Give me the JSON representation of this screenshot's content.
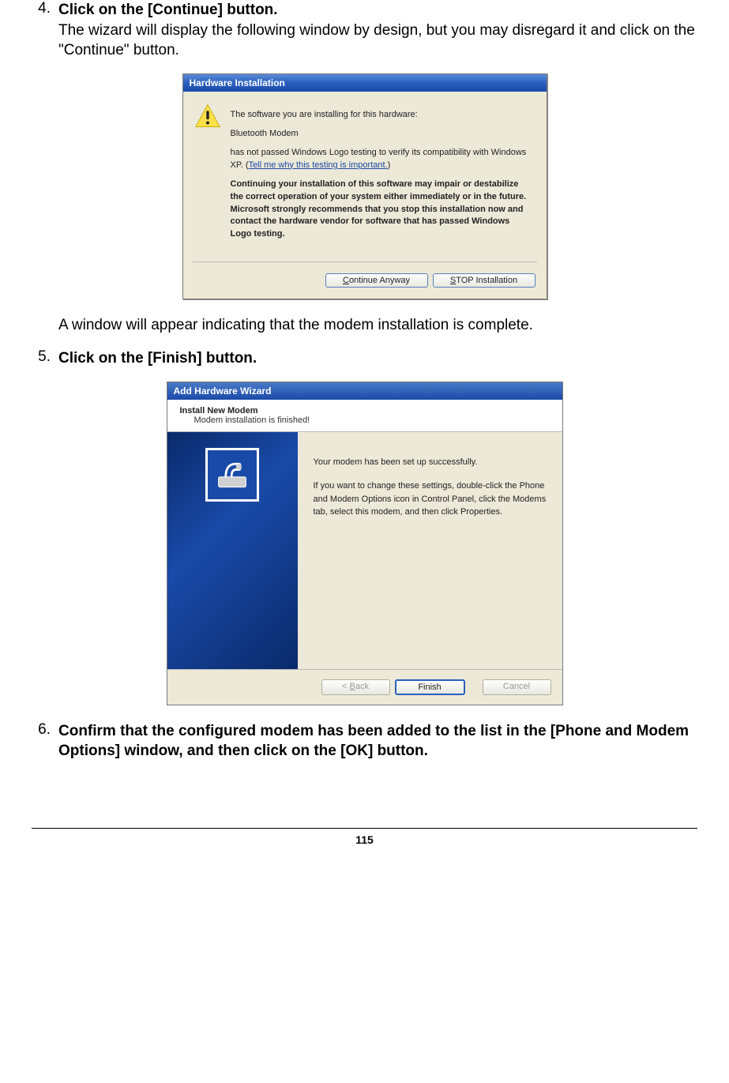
{
  "steps": {
    "s4": {
      "num": "4.",
      "bold": "Click on the [Continue] button.",
      "desc": "The wizard will display the following window by design, but you may disregard it and click on the \"Continue\" button."
    },
    "post4": "A window will appear indicating that the modem installation is complete.",
    "s5": {
      "num": "5.",
      "bold": "Click on the [Finish] button."
    },
    "s6": {
      "num": "6.",
      "bold": "Confirm that the configured modem has been added to the list in the [Phone and Modem Options] window, and then click on the [OK] button."
    }
  },
  "dialog1": {
    "title": "Hardware Installation",
    "line1": "The software you are installing for this hardware:",
    "line2": "Bluetooth Modem",
    "line3a": "has not passed Windows Logo testing to verify its compatibility with Windows XP. (",
    "link": "Tell me why this testing is important.",
    "line3b": ")",
    "bold": "Continuing your installation of this software may impair or destabilize the correct operation of your system either immediately or in the future. Microsoft strongly recommends that you stop this installation now and contact the hardware vendor for software that has passed Windows Logo testing.",
    "btn_continue_pre": "C",
    "btn_continue_post": "ontinue Anyway",
    "btn_stop_pre": "S",
    "btn_stop_post": "TOP Installation"
  },
  "dialog2": {
    "title": "Add Hardware Wizard",
    "heading": "Install New Modem",
    "sub": "Modem installation is finished!",
    "body1": "Your modem has been set up successfully.",
    "body2": "If you want to change these settings, double-click the Phone and Modem Options icon in Control Panel, click the Modems tab, select this modem, and then click Properties.",
    "back_pre": "< ",
    "back_u": "B",
    "back_post": "ack",
    "finish": "Finish",
    "cancel": "Cancel"
  },
  "pageNumber": "115"
}
